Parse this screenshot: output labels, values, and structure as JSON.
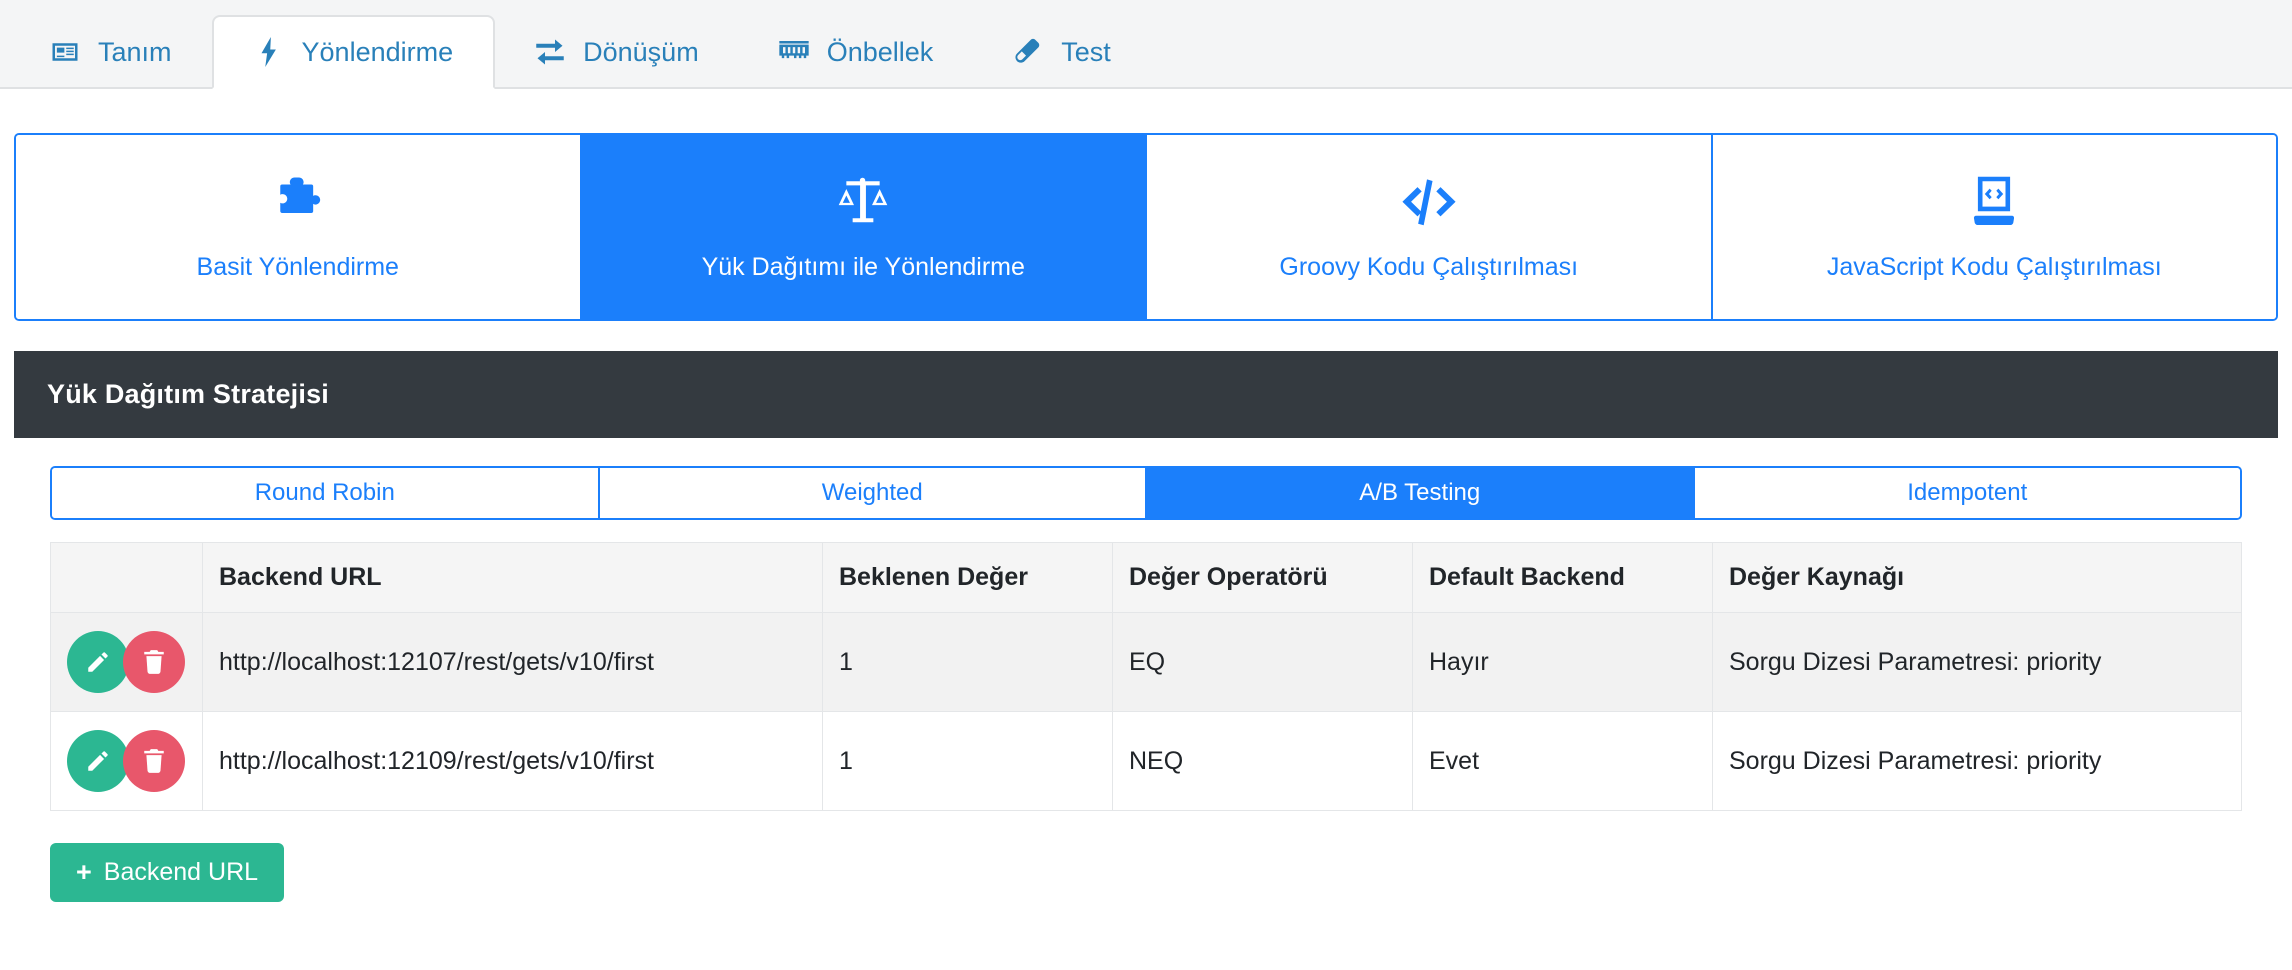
{
  "top_tabs": [
    {
      "label": "Tanım",
      "icon": "id-card-icon",
      "active": false
    },
    {
      "label": "Yönlendirme",
      "icon": "bolt-icon",
      "active": true
    },
    {
      "label": "Dönüşüm",
      "icon": "exchange-icon",
      "active": false
    },
    {
      "label": "Önbellek",
      "icon": "memory-icon",
      "active": false
    },
    {
      "label": "Test",
      "icon": "test-tube-icon",
      "active": false
    }
  ],
  "strategy_cards": [
    {
      "label": "Basit Yönlendirme",
      "icon": "puzzle-piece-icon",
      "active": false
    },
    {
      "label": "Yük Dağıtımı ile Yönlendirme",
      "icon": "balance-scale-icon",
      "active": true
    },
    {
      "label": "Groovy Kodu Çalıştırılması",
      "icon": "code-icon",
      "active": false
    },
    {
      "label": "JavaScript Kodu Çalıştırılması",
      "icon": "mobile-code-icon",
      "active": false
    }
  ],
  "panel": {
    "title": "Yük Dağıtım Stratejisi",
    "sub_tabs": [
      {
        "label": "Round Robin",
        "active": false
      },
      {
        "label": "Weighted",
        "active": false
      },
      {
        "label": "A/B Testing",
        "active": true
      },
      {
        "label": "Idempotent",
        "active": false
      }
    ],
    "table": {
      "headers": [
        "",
        "Backend URL",
        "Beklenen Değer",
        "Değer Operatörü",
        "Default Backend",
        "Değer Kaynağı"
      ],
      "rows": [
        {
          "url": "http://localhost:12107/rest/gets/v10/first",
          "expected_value": "1",
          "operator": "EQ",
          "default_backend": "Hayır",
          "value_source": "Sorgu Dizesi Parametresi: priority",
          "edit_label": "Düzenle",
          "delete_label": "Sil"
        },
        {
          "url": "http://localhost:12109/rest/gets/v10/first",
          "expected_value": "1",
          "operator": "NEQ",
          "default_backend": "Evet",
          "value_source": "Sorgu Dizesi Parametresi: priority",
          "edit_label": "Düzenle",
          "delete_label": "Sil"
        }
      ]
    },
    "add_button": {
      "plus": "+",
      "label": "Backend URL"
    }
  },
  "colors": {
    "primary_blue": "#1b7ffb",
    "tab_blue": "#2980b9",
    "dark_header": "#343a40",
    "green": "#2cb792",
    "red": "#e8576b",
    "row_alt": "#f2f2f2"
  }
}
